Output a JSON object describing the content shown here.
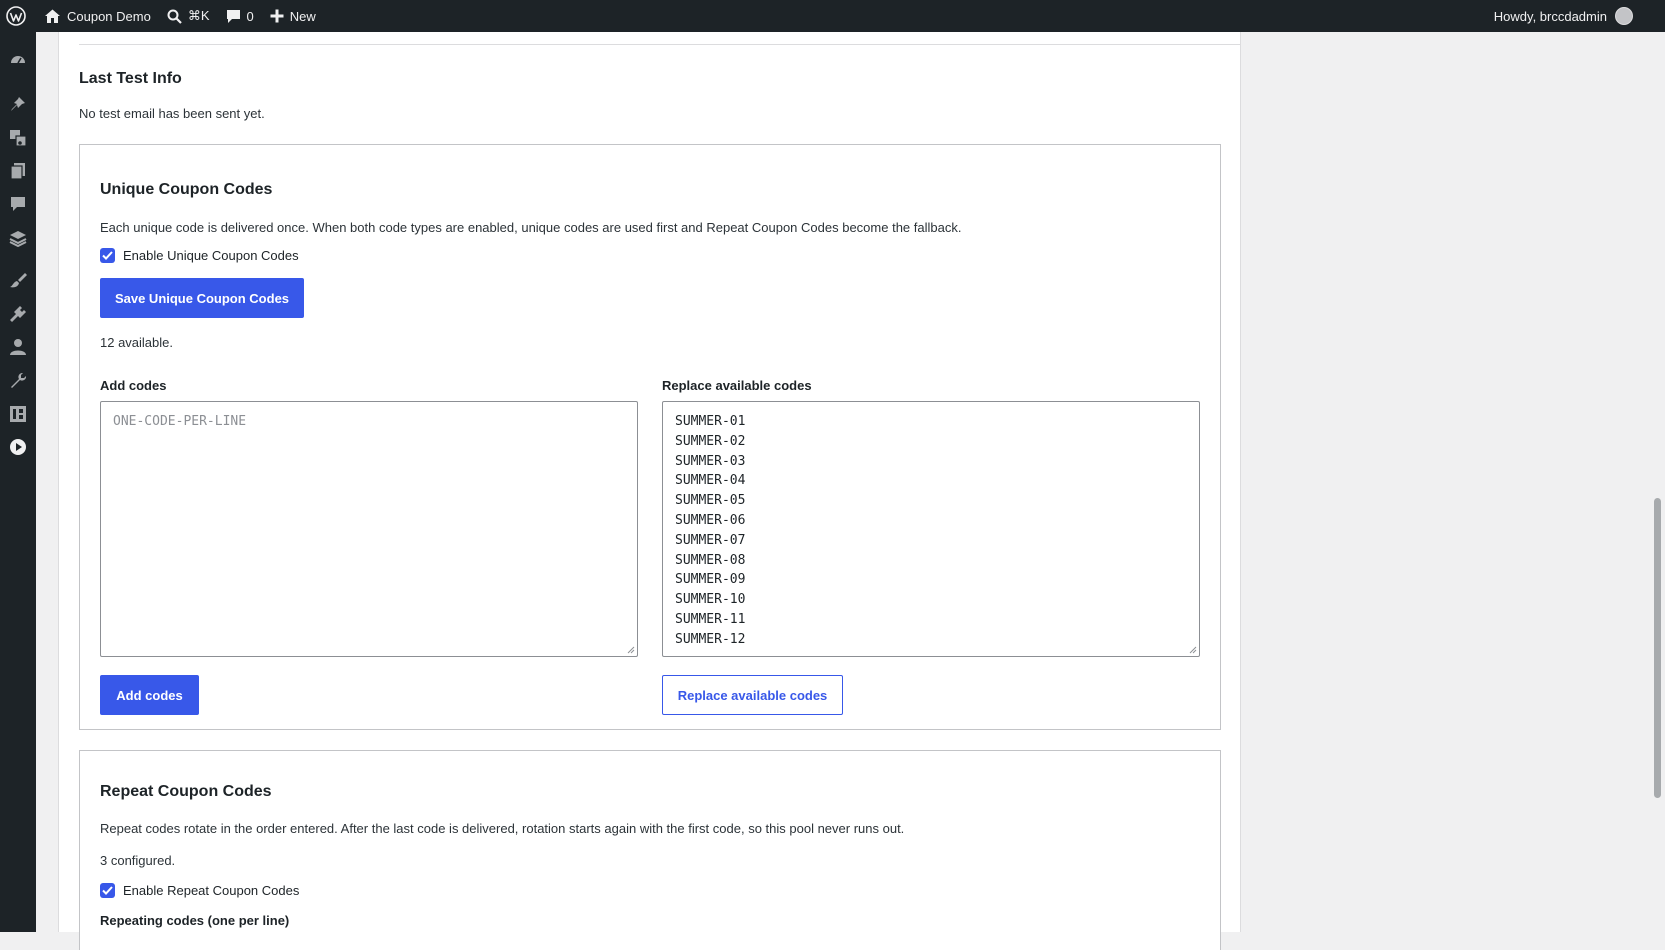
{
  "adminbar": {
    "site_name": "Coupon Demo",
    "search_shortcut": "⌘K",
    "comments_count": "0",
    "new_label": "New",
    "howdy": "Howdy, brccdadmin"
  },
  "sidebar": {
    "items": [
      {
        "icon": "dashboard-icon"
      },
      {
        "icon": "pin-icon"
      },
      {
        "icon": "media-icon"
      },
      {
        "icon": "pages-icon"
      },
      {
        "icon": "comments-icon"
      },
      {
        "icon": "layers-icon"
      },
      {
        "icon": "brush-icon"
      },
      {
        "icon": "plugin-icon"
      },
      {
        "icon": "users-icon"
      },
      {
        "icon": "tools-icon"
      },
      {
        "icon": "settings-icon"
      },
      {
        "icon": "play-icon"
      }
    ]
  },
  "last_test": {
    "title": "Last Test Info",
    "text": "No test email has been sent yet."
  },
  "unique": {
    "title": "Unique Coupon Codes",
    "description": "Each unique code is delivered once. When both code types are enabled, unique codes are used first and Repeat Coupon Codes become the fallback.",
    "enable_label": "Enable Unique Coupon Codes",
    "enabled": true,
    "save_button": "Save Unique Coupon Codes",
    "available": "12 available.",
    "add_label": "Add codes",
    "add_placeholder": "ONE-CODE-PER-LINE",
    "replace_label": "Replace available codes",
    "codes": [
      "SUMMER-01",
      "SUMMER-02",
      "SUMMER-03",
      "SUMMER-04",
      "SUMMER-05",
      "SUMMER-06",
      "SUMMER-07",
      "SUMMER-08",
      "SUMMER-09",
      "SUMMER-10",
      "SUMMER-11",
      "SUMMER-12"
    ],
    "add_button": "Add codes",
    "replace_button": "Replace available codes"
  },
  "repeat": {
    "title": "Repeat Coupon Codes",
    "description": "Repeat codes rotate in the order entered. After the last code is delivered, rotation starts again with the first code, so this pool never runs out.",
    "configured": "3 configured.",
    "enable_label": "Enable Repeat Coupon Codes",
    "enabled": true,
    "codes_label": "Repeating codes (one per line)"
  },
  "colors": {
    "accent": "#3858e9",
    "adminbar_bg": "#1d2327",
    "page_bg": "#f0f0f1"
  }
}
